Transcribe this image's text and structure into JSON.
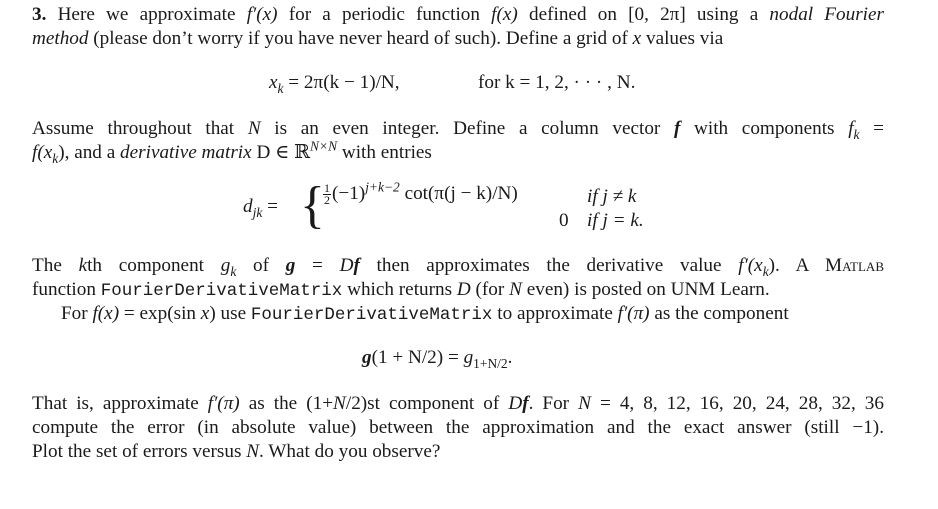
{
  "problem": {
    "number": "3.",
    "p1": {
      "l1_a": "Here we approximate ",
      "l1_fprime": "f′(x)",
      "l1_b": " for a periodic function ",
      "l1_fx": "f(x)",
      "l1_c": " defined on [0, 2π] using a ",
      "l1_em": "nodal Fourier",
      "l2_em": "method",
      "l2_a": " (please don’t worry if you have never heard of such). Define a grid of ",
      "l2_x": "x",
      "l2_b": " values via"
    },
    "eq1": {
      "lhs": "x",
      "lhs_sub": "k",
      "rhs": " = 2π(k − 1)/N,",
      "cond": "for k = 1, 2, · · · , N."
    },
    "p2": {
      "l1_a": "Assume throughout that ",
      "l1_N": "N",
      "l1_b": " is an even integer. Define a column vector ",
      "l1_f": "f",
      "l1_c": " with components ",
      "l1_fk": "f",
      "l1_fk_sub": "k",
      "l1_d": " =",
      "l2_a": "f(x",
      "l2_a_sub": "k",
      "l2_b": "), and a ",
      "l2_em": "derivative matrix",
      "l2_c": " D ∈ ℝ",
      "l2_sup": "N×N",
      "l2_d": " with entries"
    },
    "eq2": {
      "lhs": "d",
      "lhs_sub": "jk",
      "equals": " =",
      "brace": "{",
      "frac_num": "1",
      "frac_den": "2",
      "case1_a": "(−1)",
      "case1_sup": "j+k−2",
      "case1_b": " cot(π(j − k)/N)",
      "case1_cond": "if j ≠ k",
      "case2_val": "0",
      "case2_cond": "if j = k."
    },
    "p3": {
      "l1_a": "The ",
      "l1_k": "k",
      "l1_b": "th component ",
      "l1_gk": "g",
      "l1_gk_sub": "k",
      "l1_c": " of ",
      "l1_g": "g",
      "l1_d": " = ",
      "l1_D": "D",
      "l1_f": "f",
      "l1_e": " then approximates the derivative value ",
      "l1_fp": "f′(x",
      "l1_fp_sub": "k",
      "l1_fp_end": ").",
      "l1_f_gap": "  A ",
      "l1_matlab": "Matlab",
      "l2_a": "function ",
      "l2_code": "FourierDerivativeMatrix",
      "l2_b": " which returns ",
      "l2_D": "D",
      "l2_c": " (for ",
      "l2_N": "N",
      "l2_d": " even) is posted on UNM Learn.",
      "l3_a": "For ",
      "l3_f": "f(x)",
      "l3_b": " = exp(sin ",
      "l3_x": "x",
      "l3_c": ") use ",
      "l3_code": "FourierDerivativeMatrix",
      "l3_d": " to approximate ",
      "l3_fp": "f′(π)",
      "l3_e": " as the component"
    },
    "eq3": {
      "g": "g",
      "mid": "(1 + N/2) = ",
      "g2": "g",
      "sub": "1+N/2",
      "end": "."
    },
    "p4": {
      "l1_a": "That is, approximate ",
      "l1_fp": "f′(π)",
      "l1_b": " as the (1+",
      "l1_N": "N",
      "l1_c": "/2)st component of ",
      "l1_D": "D",
      "l1_f": "f",
      "l1_d": ". For ",
      "l1_N2": "N",
      "l1_e": " = 4, 8, 12, 16, 20, 24, 28, 32, 36",
      "l2": "compute the error (in absolute value) between the approximation and the exact answer (still −1).",
      "l3_a": "Plot the set of errors versus ",
      "l3_N": "N",
      "l3_b": ". What do you observe?"
    }
  }
}
